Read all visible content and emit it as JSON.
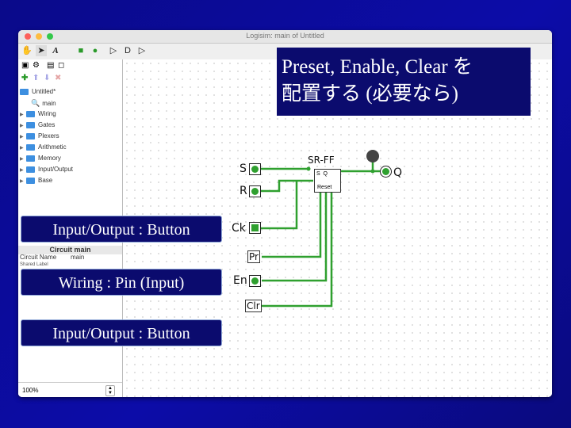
{
  "window": {
    "title": "Logisim: main of Untitled"
  },
  "toolbar": {
    "icons": [
      "hand-icon",
      "arrow-icon",
      "text-icon",
      "input-pin-icon",
      "output-pin-icon",
      "not-gate-icon",
      "and-gate-icon",
      "or-gate-icon"
    ]
  },
  "tree": {
    "root": "Untitled*",
    "main": "main",
    "items": [
      "Wiring",
      "Gates",
      "Plexers",
      "Arithmetic",
      "Memory",
      "Input/Output",
      "Base"
    ]
  },
  "props": {
    "circuit_title": "Circuit main",
    "name_key": "Circuit Name",
    "name_val": "main",
    "shared_label": "Shared Label"
  },
  "zoom": {
    "value": "100%"
  },
  "callout": {
    "line1": "Preset, Enable, Clear を",
    "line2": "配置する (必要なら)"
  },
  "labels": {
    "btn1": "Input/Output : Button",
    "btn2": "Wiring : Pin (Input)",
    "btn3": "Input/Output : Button"
  },
  "circuit": {
    "ff_title": "SR-FF",
    "ff_body": "S  Q",
    "ff_reset": "Reset",
    "s": "S",
    "r": "R",
    "ck": "Ck",
    "pr": "Pr",
    "en": "En",
    "clr": "Clr",
    "q": "Q",
    "pin_val": "0"
  },
  "colors": {
    "wire": "#2fa02f",
    "bg": "#0c0ca8",
    "box": "#0b0b6e"
  }
}
